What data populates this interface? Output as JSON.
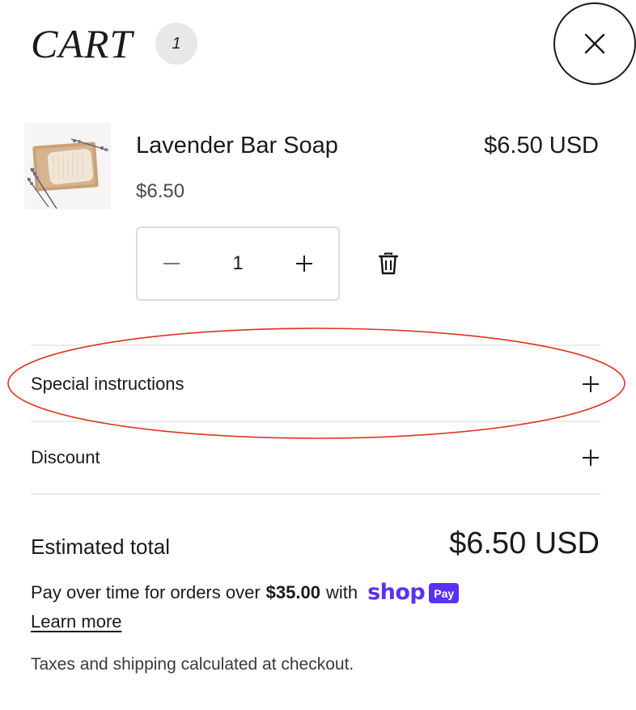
{
  "header": {
    "title": "CART",
    "item_count": "1"
  },
  "cart": {
    "items": [
      {
        "name": "Lavender Bar Soap",
        "unit_price": "$6.50",
        "line_price": "$6.50 USD",
        "quantity": "1"
      }
    ]
  },
  "accordions": [
    {
      "label": "Special instructions",
      "highlighted": true
    },
    {
      "label": "Discount",
      "highlighted": false
    }
  ],
  "totals": {
    "label": "Estimated total",
    "value": "$6.50 USD"
  },
  "installments": {
    "prefix": "Pay over time for orders over",
    "threshold": "$35.00",
    "suffix": "with",
    "shop_logo_text": "shop",
    "pay_badge_text": "Pay",
    "learn_more": "Learn more"
  },
  "footer": {
    "tax_note": "Taxes and shipping calculated at checkout."
  },
  "colors": {
    "shop_pay_purple": "#5a31f4",
    "highlight_red": "#e0331f",
    "divider": "#ececec"
  },
  "icons": {
    "close": "close-icon",
    "minus": "minus-icon",
    "plus": "plus-icon",
    "remove": "trash-icon"
  }
}
